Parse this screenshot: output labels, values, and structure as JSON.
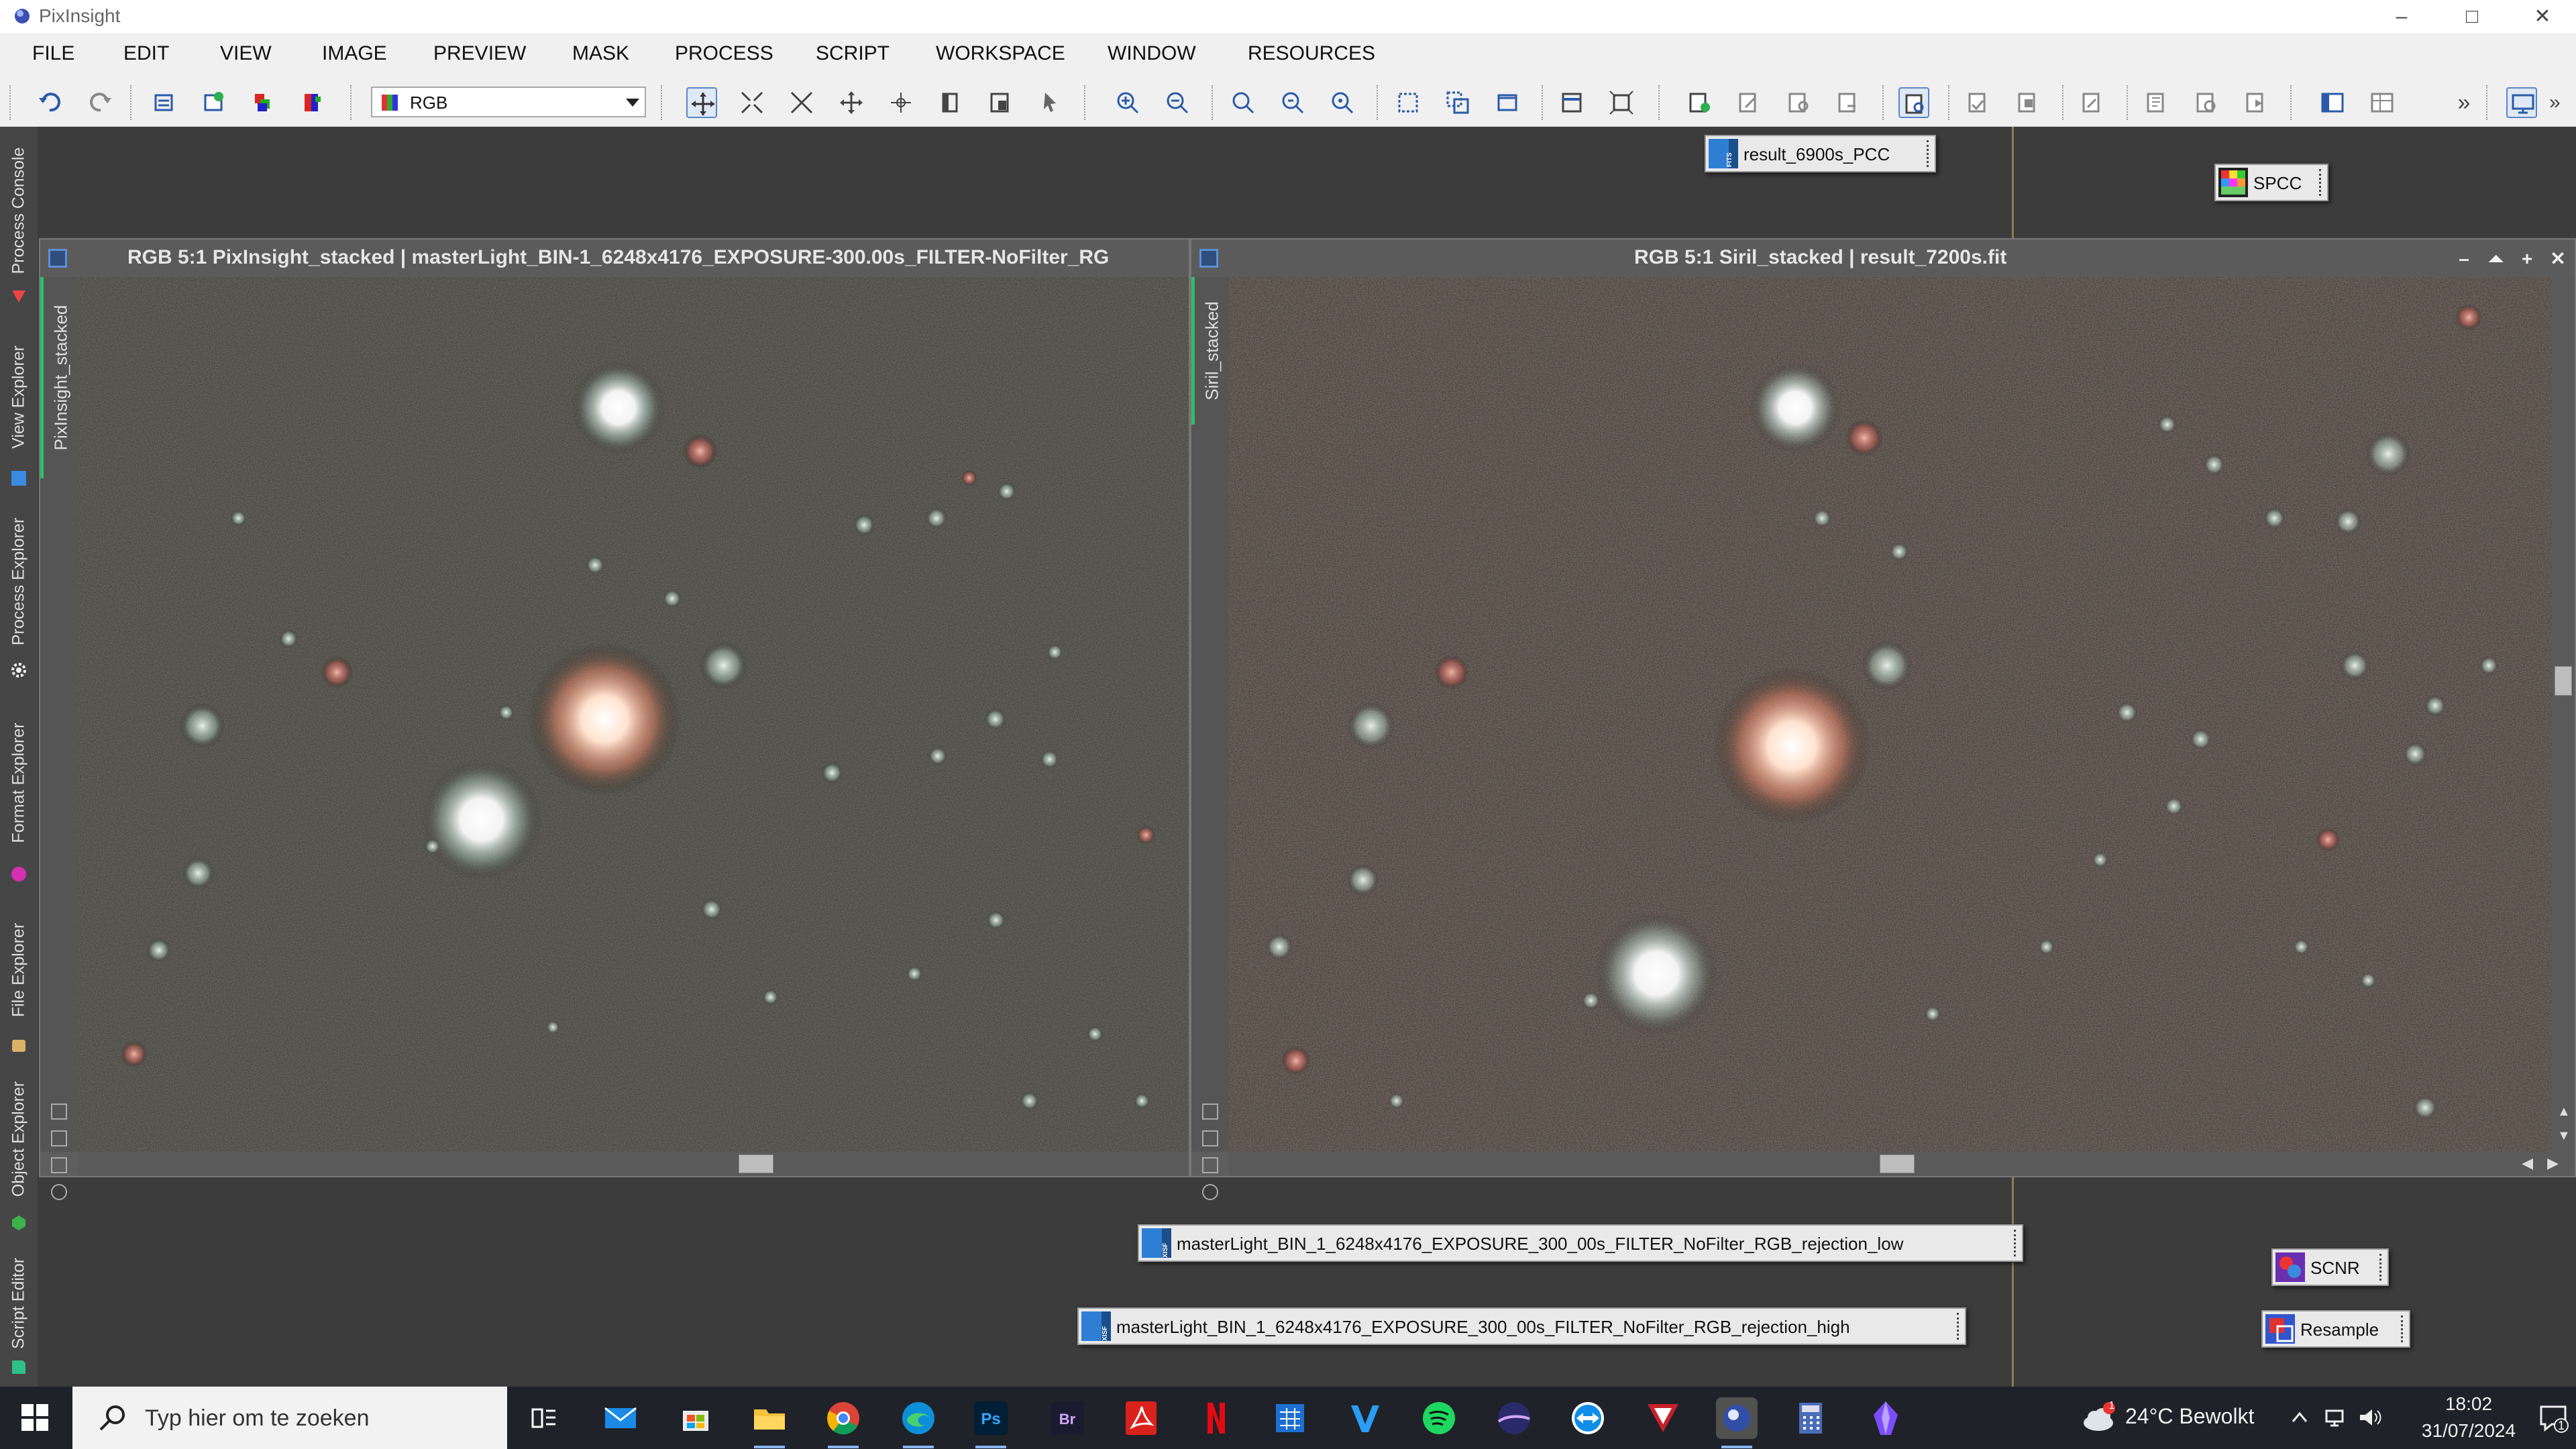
{
  "app": {
    "title": "PixInsight"
  },
  "window_controls": {
    "minimize": "–",
    "maximize": "□",
    "close": "✕"
  },
  "menu": [
    "FILE",
    "EDIT",
    "VIEW",
    "IMAGE",
    "PREVIEW",
    "MASK",
    "PROCESS",
    "SCRIPT",
    "WORKSPACE",
    "WINDOW",
    "RESOURCES"
  ],
  "toolbar": {
    "channel_select": {
      "value": "RGB"
    },
    "overflow_label": "»"
  },
  "left_tabs": [
    "Process Console",
    "View Explorer",
    "Process Explorer",
    "Format Explorer",
    "File Explorer",
    "Object Explorer",
    "Script Editor"
  ],
  "icons": {
    "result_pcc": {
      "label": "result_6900s_PCC",
      "badge": "FITS"
    },
    "spcc": {
      "label": "SPCC"
    },
    "rejection_low": {
      "label": "masterLight_BIN_1_6248x4176_EXPOSURE_300_00s_FILTER_NoFilter_RGB_rejection_low",
      "badge": "XISF"
    },
    "rejection_high": {
      "label": "masterLight_BIN_1_6248x4176_EXPOSURE_300_00s_FILTER_NoFilter_RGB_rejection_high",
      "badge": "XISF"
    },
    "scnr": {
      "label": "SCNR"
    },
    "resample": {
      "label": "Resample"
    }
  },
  "windows": {
    "left": {
      "title": "RGB 5:1 PixInsight_stacked | masterLight_BIN-1_6248x4176_EXPOSURE-300.00s_FILTER-NoFilter_RG",
      "view_tab": "PixInsight_stacked"
    },
    "right": {
      "title": "RGB 5:1 Siril_stacked | result_7200s.fit",
      "view_tab": "Siril_stacked",
      "controls": {
        "minimize": "–",
        "shade": "⏶",
        "maximize": "+",
        "close": "✕"
      }
    }
  },
  "taskbar": {
    "search_placeholder": "Typ hier om te zoeken",
    "weather": "24°C  Bewolkt",
    "weather_badge": "1",
    "time": "18:02",
    "date": "31/07/2024",
    "notification_count": "1",
    "apps": [
      "task-view",
      "mail",
      "store",
      "file-explorer",
      "chrome",
      "edge",
      "photoshop",
      "bridge",
      "acrobat",
      "netflix",
      "calculator-alt",
      "vegas",
      "spotify",
      "stellarium",
      "teamviewer",
      "app-red",
      "pixinsight",
      "calculator",
      "obsidian"
    ]
  }
}
